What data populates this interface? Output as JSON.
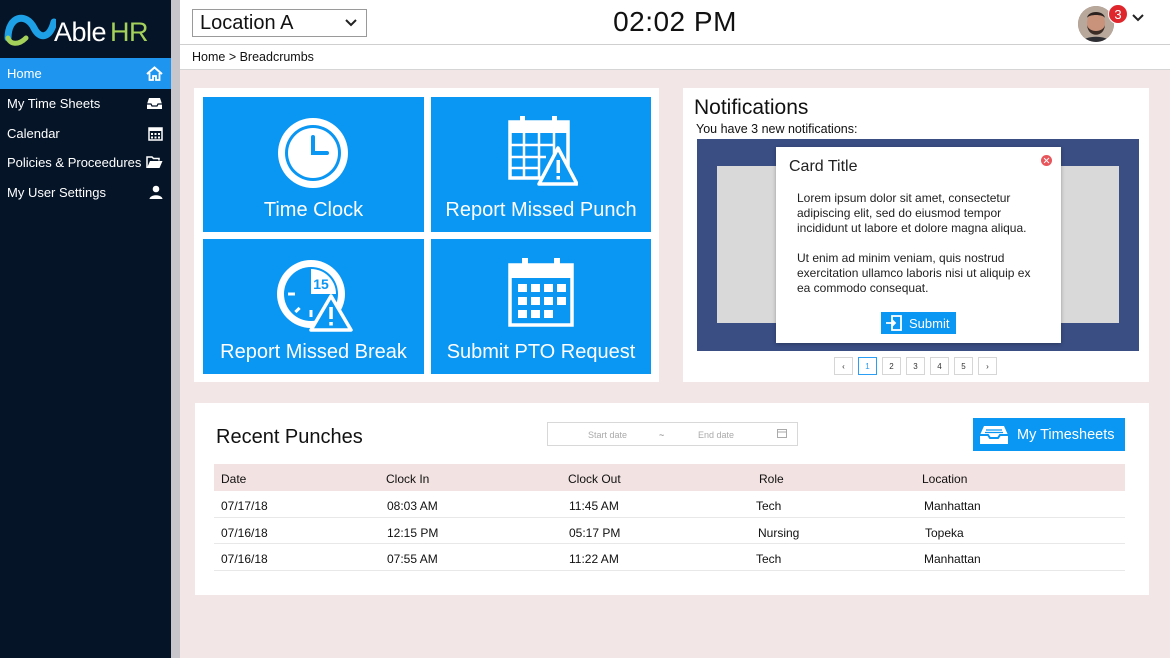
{
  "app": {
    "logo_text_a": "Able",
    "logo_text_b": "HR"
  },
  "sidebar": {
    "items": [
      {
        "label": "Home",
        "icon": "home-icon"
      },
      {
        "label": "My Time Sheets",
        "icon": "inbox-tray-icon"
      },
      {
        "label": "Calendar",
        "icon": "calendar-icon"
      },
      {
        "label": "Policies & Proceedures",
        "icon": "folder-open-icon"
      },
      {
        "label": "My User Settings",
        "icon": "user-icon"
      }
    ]
  },
  "topbar": {
    "location": "Location A",
    "time": "02:02 PM",
    "notification_count": "3"
  },
  "breadcrumb": "Home > Breadcrumbs",
  "tiles": [
    {
      "label": "Time Clock",
      "icon": "clock-icon"
    },
    {
      "label": "Report Missed Punch",
      "icon": "calendar-warning-icon"
    },
    {
      "label": "Report Missed Break",
      "icon": "timer-warning-icon",
      "timer_number": "15"
    },
    {
      "label": "Submit PTO Request",
      "icon": "calendar-icon"
    }
  ],
  "notifications": {
    "title": "Notifications",
    "subtitle": "You have 3 new notifications:",
    "card": {
      "title": "Card Title",
      "para1": "Lorem ipsum dolor sit amet, consectetur adipiscing elit, sed do eiusmod tempor incididunt ut labore et dolore magna aliqua.",
      "para2": "Ut enim ad minim veniam, quis nostrud exercitation ullamco laboris nisi ut aliquip ex ea commodo consequat.",
      "submit_label": "Submit"
    },
    "pager": {
      "prev": "‹",
      "pages": [
        "1",
        "2",
        "3",
        "4",
        "5"
      ],
      "next": "›",
      "active": "1"
    }
  },
  "punches": {
    "title": "Recent Punches",
    "start_placeholder": "Start date",
    "separator": "~",
    "end_placeholder": "End date",
    "button_label": "My Timesheets",
    "columns": [
      "Date",
      "Clock In",
      "Clock Out",
      "Role",
      "Location"
    ],
    "rows": [
      [
        "07/17/18",
        "08:03 AM",
        "11:45 AM",
        "Tech",
        "Manhattan"
      ],
      [
        "07/16/18",
        "12:15 PM",
        "05:17 PM",
        "Nursing",
        "Topeka"
      ],
      [
        "07/16/18",
        "07:55 AM",
        "11:22 AM",
        "Tech",
        "Manhattan"
      ]
    ]
  },
  "colors": {
    "accent": "#0a96f3",
    "sidebar": "#061427",
    "carousel": "#3a4e84"
  }
}
